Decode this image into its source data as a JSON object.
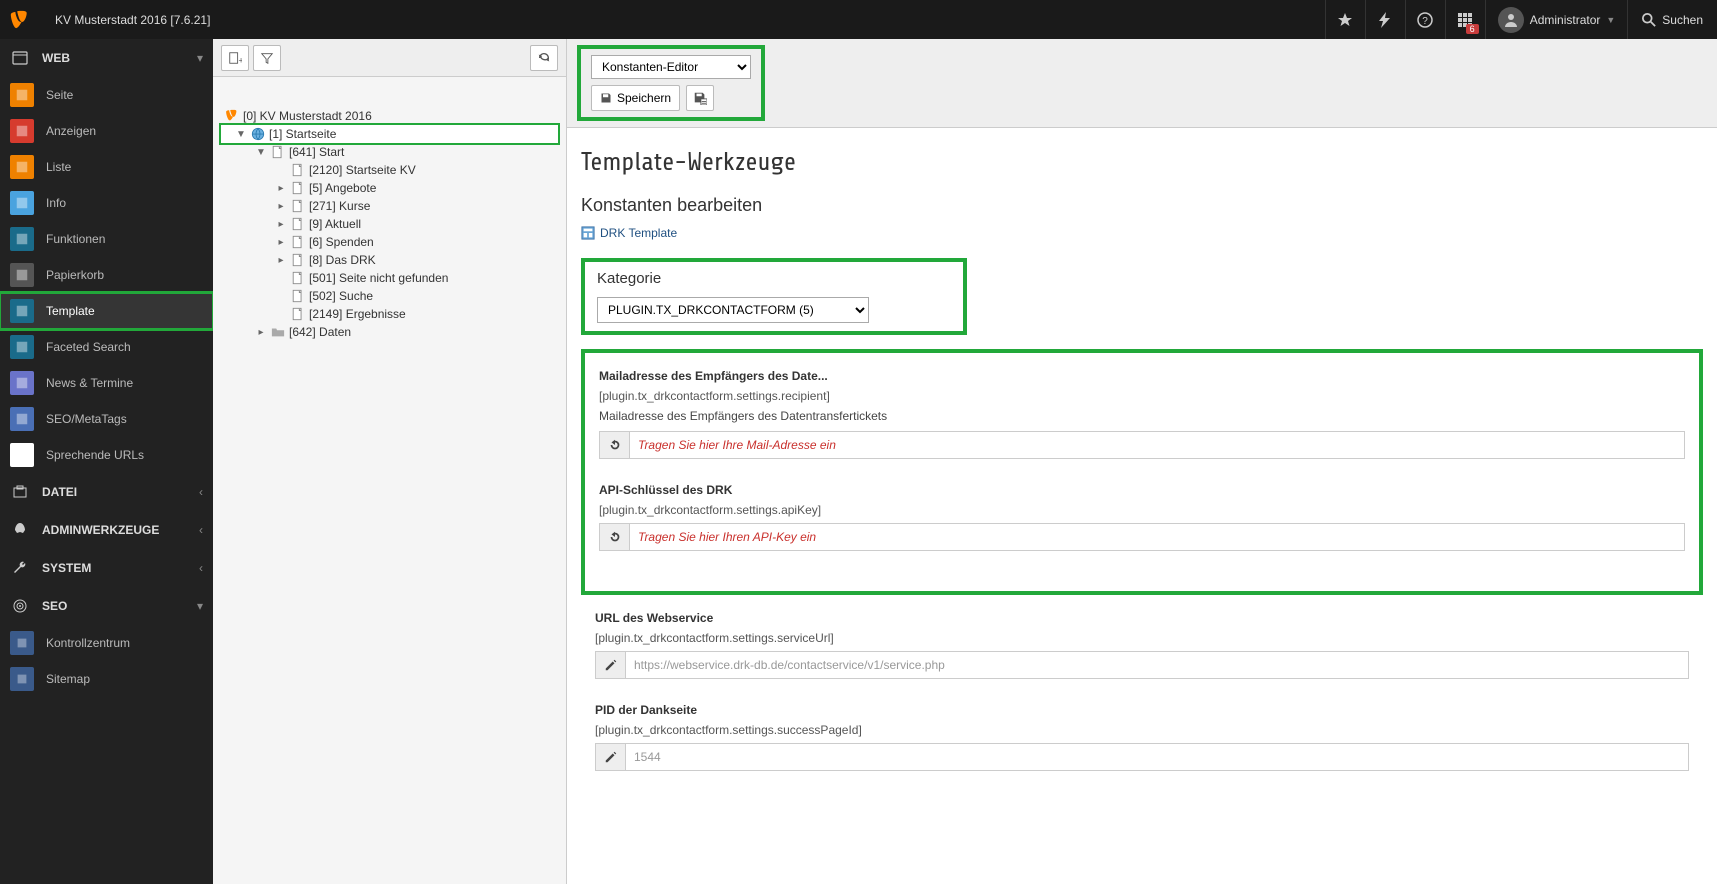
{
  "topbar": {
    "title": "KV Musterstadt 2016 [7.6.21]",
    "badge": "6",
    "user": "Administrator",
    "search": "Suchen"
  },
  "modmenu": {
    "web": {
      "label": "WEB",
      "items": [
        {
          "label": "Seite",
          "color": "#ef8100"
        },
        {
          "label": "Anzeigen",
          "color": "#d63b2e"
        },
        {
          "label": "Liste",
          "color": "#ef8100"
        },
        {
          "label": "Info",
          "color": "#4aa3df"
        },
        {
          "label": "Funktionen",
          "color": "#1a6b8a"
        },
        {
          "label": "Papierkorb",
          "color": "#555"
        },
        {
          "label": "Template",
          "color": "#1a6b8a",
          "active": true
        },
        {
          "label": "Faceted Search",
          "color": "#1a6b8a"
        },
        {
          "label": "News & Termine",
          "color": "#6a73c9"
        },
        {
          "label": "SEO/MetaTags",
          "color": "#4a6fb5"
        },
        {
          "label": "Sprechende URLs",
          "color": "#fff"
        }
      ]
    },
    "datei": "DATEI",
    "admin": "ADMINWERKZEUGE",
    "system": "SYSTEM",
    "seo": "SEO",
    "seo_items": [
      {
        "label": "Kontrollzentrum"
      },
      {
        "label": "Sitemap"
      }
    ]
  },
  "tree": {
    "root": "[0] KV Musterstadt 2016",
    "items": [
      {
        "label": "[1] Startseite",
        "ind": 1,
        "toggle": "▼",
        "selected": true,
        "globe": true
      },
      {
        "label": "[641] Start",
        "ind": 2,
        "toggle": "▼"
      },
      {
        "label": "[2120] Startseite KV",
        "ind": 3,
        "toggle": ""
      },
      {
        "label": "[5] Angebote",
        "ind": 3,
        "toggle": "▸"
      },
      {
        "label": "[271] Kurse",
        "ind": 3,
        "toggle": "▸"
      },
      {
        "label": "[9] Aktuell",
        "ind": 3,
        "toggle": "▸"
      },
      {
        "label": "[6] Spenden",
        "ind": 3,
        "toggle": "▸"
      },
      {
        "label": "[8] Das DRK",
        "ind": 3,
        "toggle": "▸"
      },
      {
        "label": "[501] Seite nicht gefunden",
        "ind": 3,
        "toggle": ""
      },
      {
        "label": "[502] Suche",
        "ind": 3,
        "toggle": ""
      },
      {
        "label": "[2149] Ergebnisse",
        "ind": 3,
        "toggle": ""
      },
      {
        "label": "[642] Daten",
        "ind": 2,
        "toggle": "▸",
        "folder": true
      }
    ]
  },
  "docheader": {
    "mode": "Konstanten-Editor",
    "save": "Speichern"
  },
  "content": {
    "h1": "Template-Werkzeuge",
    "h2": "Konstanten bearbeiten",
    "templateLink": "DRK Template",
    "category_label": "Kategorie",
    "category_value": "PLUGIN.TX_DRKCONTACTFORM (5)",
    "fields": [
      {
        "title": "Mailadresse des Empfängers des Date...",
        "path": "[plugin.tx_drkcontactform.settings.recipient]",
        "desc": "Mailadresse des Empfängers des Datentransfertickets",
        "placeholder": "Tragen Sie hier Ihre Mail-Adresse ein",
        "prefix": "undo",
        "phclass": "redph"
      },
      {
        "title": "API-Schlüssel des DRK",
        "path": "[plugin.tx_drkcontactform.settings.apiKey]",
        "desc": "",
        "placeholder": "Tragen Sie hier Ihren API-Key ein",
        "prefix": "undo",
        "phclass": "redph"
      }
    ],
    "plain_fields": [
      {
        "title": "URL des Webservice",
        "path": "[plugin.tx_drkcontactform.settings.serviceUrl]",
        "placeholder": "https://webservice.drk-db.de/contactservice/v1/service.php",
        "prefix": "pencil",
        "phclass": "grayph"
      },
      {
        "title": "PID der Dankseite",
        "path": "[plugin.tx_drkcontactform.settings.successPageId]",
        "placeholder": "1544",
        "prefix": "pencil",
        "phclass": "grayph"
      }
    ]
  }
}
